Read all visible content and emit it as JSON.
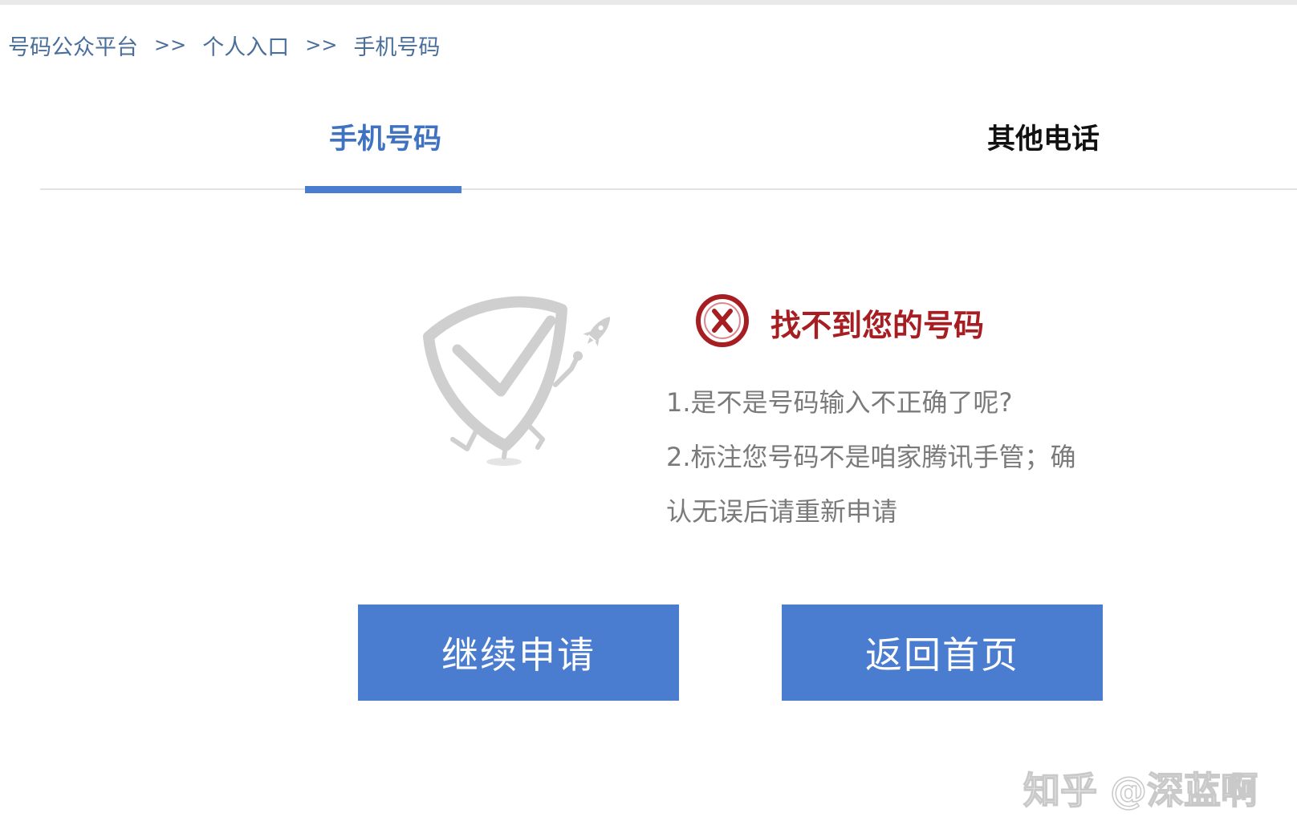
{
  "breadcrumb": {
    "items": [
      "号码公众平台",
      "个人入口",
      "手机号码"
    ],
    "separator": ">>"
  },
  "tabs": [
    {
      "label": "手机号码",
      "active": true
    },
    {
      "label": "其他电话",
      "active": false
    }
  ],
  "error": {
    "icon": "error-x-icon",
    "title": "找不到您的号码",
    "tips": [
      "1.是不是号码输入不正确了呢?",
      "2.标注您号码不是咱家腾讯手管；确",
      "认无误后请重新申请"
    ]
  },
  "buttons": {
    "continue_label": "继续申请",
    "home_label": "返回首页"
  },
  "watermark": "知乎 @深蓝啊",
  "colors": {
    "accent": "#4a7dd0",
    "tab_active": "#3f72c1",
    "error": "#a61d22",
    "breadcrumb": "#4a6f9a",
    "tip_text": "#7a7a7a"
  }
}
